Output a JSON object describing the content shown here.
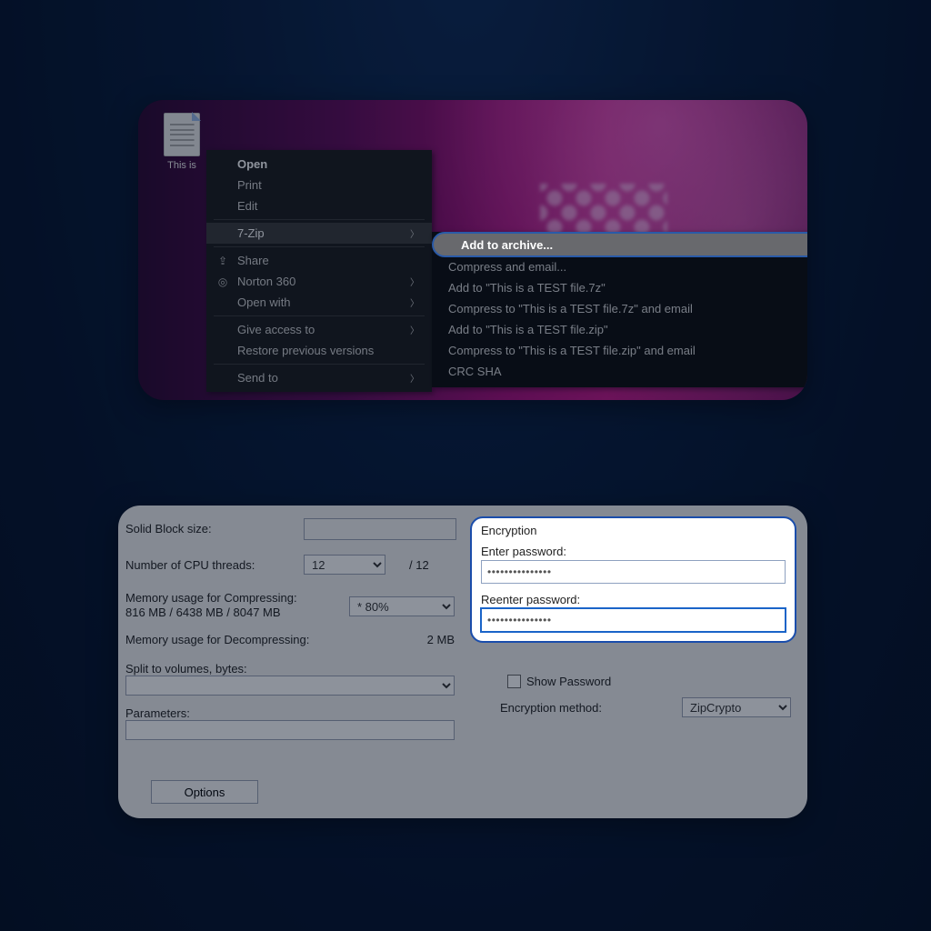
{
  "file_icon": {
    "label": "This is"
  },
  "context_menu": {
    "open": "Open",
    "print": "Print",
    "edit": "Edit",
    "seven_zip": "7-Zip",
    "share": "Share",
    "norton": "Norton 360",
    "open_with": "Open with",
    "give_access": "Give access to",
    "restore": "Restore previous versions",
    "send_to": "Send to"
  },
  "submenu": {
    "add_archive": "Add to archive...",
    "compress_email": "Compress and email...",
    "add_7z": "Add to \"This is a TEST file.7z\"",
    "compress_7z_email": "Compress to \"This is a TEST file.7z\" and email",
    "add_zip": "Add to \"This is a TEST file.zip\"",
    "compress_zip_email": "Compress to \"This is a TEST file.zip\" and email",
    "crc_sha": "CRC SHA"
  },
  "dialog": {
    "solid_block_label": "Solid Block size:",
    "threads_label": "Number of CPU threads:",
    "threads_value": "12",
    "threads_max": "/ 12",
    "mem_compress_label": "Memory usage for Compressing:",
    "mem_compress_values": "816 MB / 6438 MB / 8047 MB",
    "mem_pct_value": "* 80%",
    "mem_decompress_label": "Memory usage for Decompressing:",
    "mem_decompress_value": "2 MB",
    "split_label": "Split to volumes, bytes:",
    "params_label": "Parameters:",
    "options_btn": "Options"
  },
  "encryption": {
    "title": "Encryption",
    "enter_label": "Enter password:",
    "enter_value": "***************",
    "reenter_label": "Reenter password:",
    "reenter_value": "***************",
    "show_pw": "Show Password",
    "method_label": "Encryption method:",
    "method_value": "ZipCrypto"
  }
}
